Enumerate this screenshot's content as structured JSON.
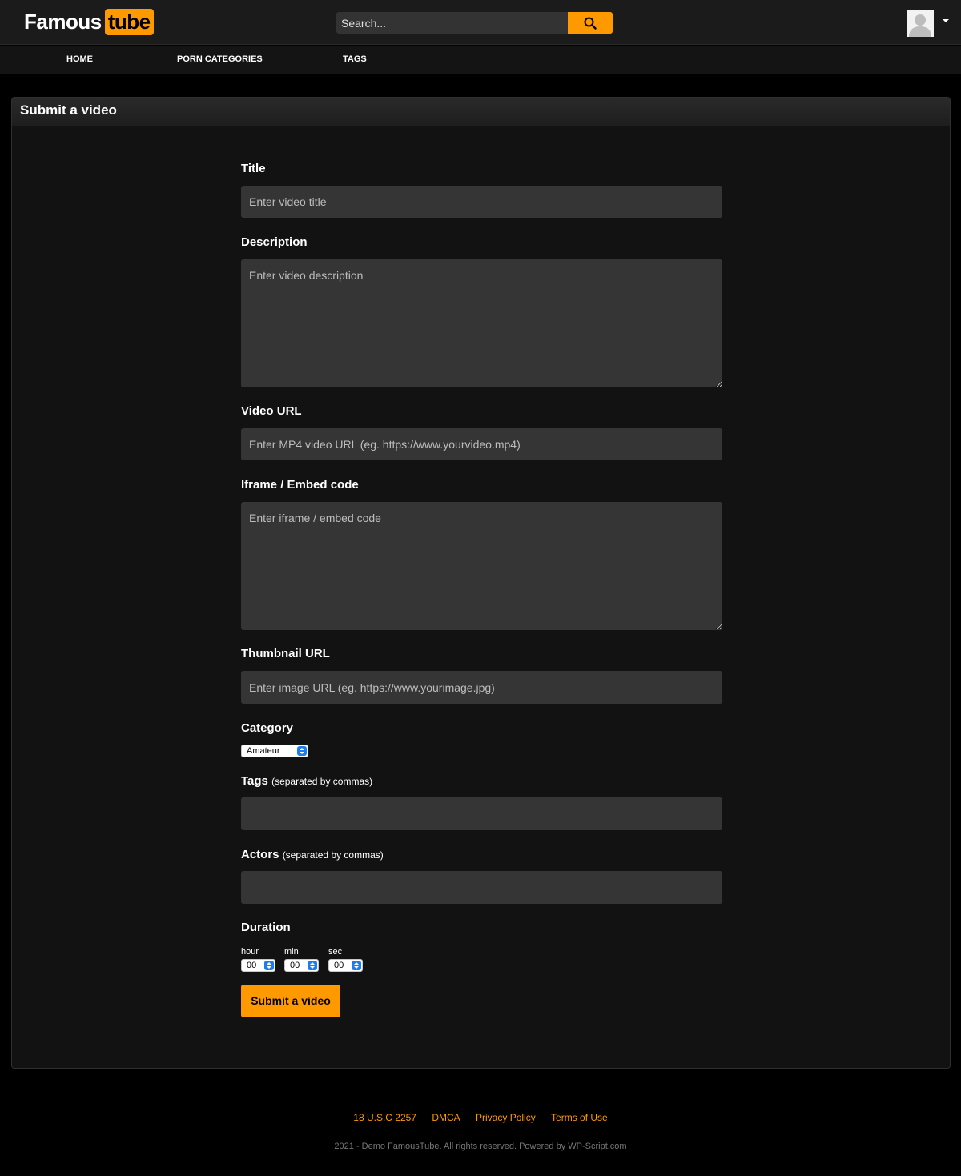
{
  "header": {
    "logo_part1": "Famous",
    "logo_part2": "tube",
    "search_placeholder": "Search...",
    "search_icon": "search-icon",
    "avatar_icon": "user-avatar-icon",
    "accent_color": "#ff9900"
  },
  "nav": {
    "items": [
      {
        "label": "HOME"
      },
      {
        "label": "PORN CATEGORIES"
      },
      {
        "label": "TAGS"
      }
    ]
  },
  "page": {
    "title": "Submit a video"
  },
  "form": {
    "title_label": "Title",
    "title_placeholder": "Enter video title",
    "description_label": "Description",
    "description_placeholder": "Enter video description",
    "video_url_label": "Video URL",
    "video_url_placeholder": "Enter MP4 video URL (eg. https://www.yourvideo.mp4)",
    "embed_label": "Iframe / Embed code",
    "embed_placeholder": "Enter iframe / embed code",
    "thumbnail_label": "Thumbnail URL",
    "thumbnail_placeholder": "Enter image URL (eg. https://www.yourimage.jpg)",
    "category_label": "Category",
    "category_value": "Amateur",
    "tags_label": "Tags",
    "tags_hint": "(separated by commas)",
    "actors_label": "Actors",
    "actors_hint": "(separated by commas)",
    "duration_label": "Duration",
    "hour_label": "hour",
    "hour_value": "00",
    "min_label": "min",
    "min_value": "00",
    "sec_label": "sec",
    "sec_value": "00",
    "submit_label": "Submit a video"
  },
  "footer": {
    "links": [
      "18 U.S.C 2257",
      "DMCA",
      "Privacy Policy",
      "Terms of Use"
    ],
    "copyright": "2021 - Demo FamousTube. All rights reserved. Powered by WP-Script.com"
  }
}
